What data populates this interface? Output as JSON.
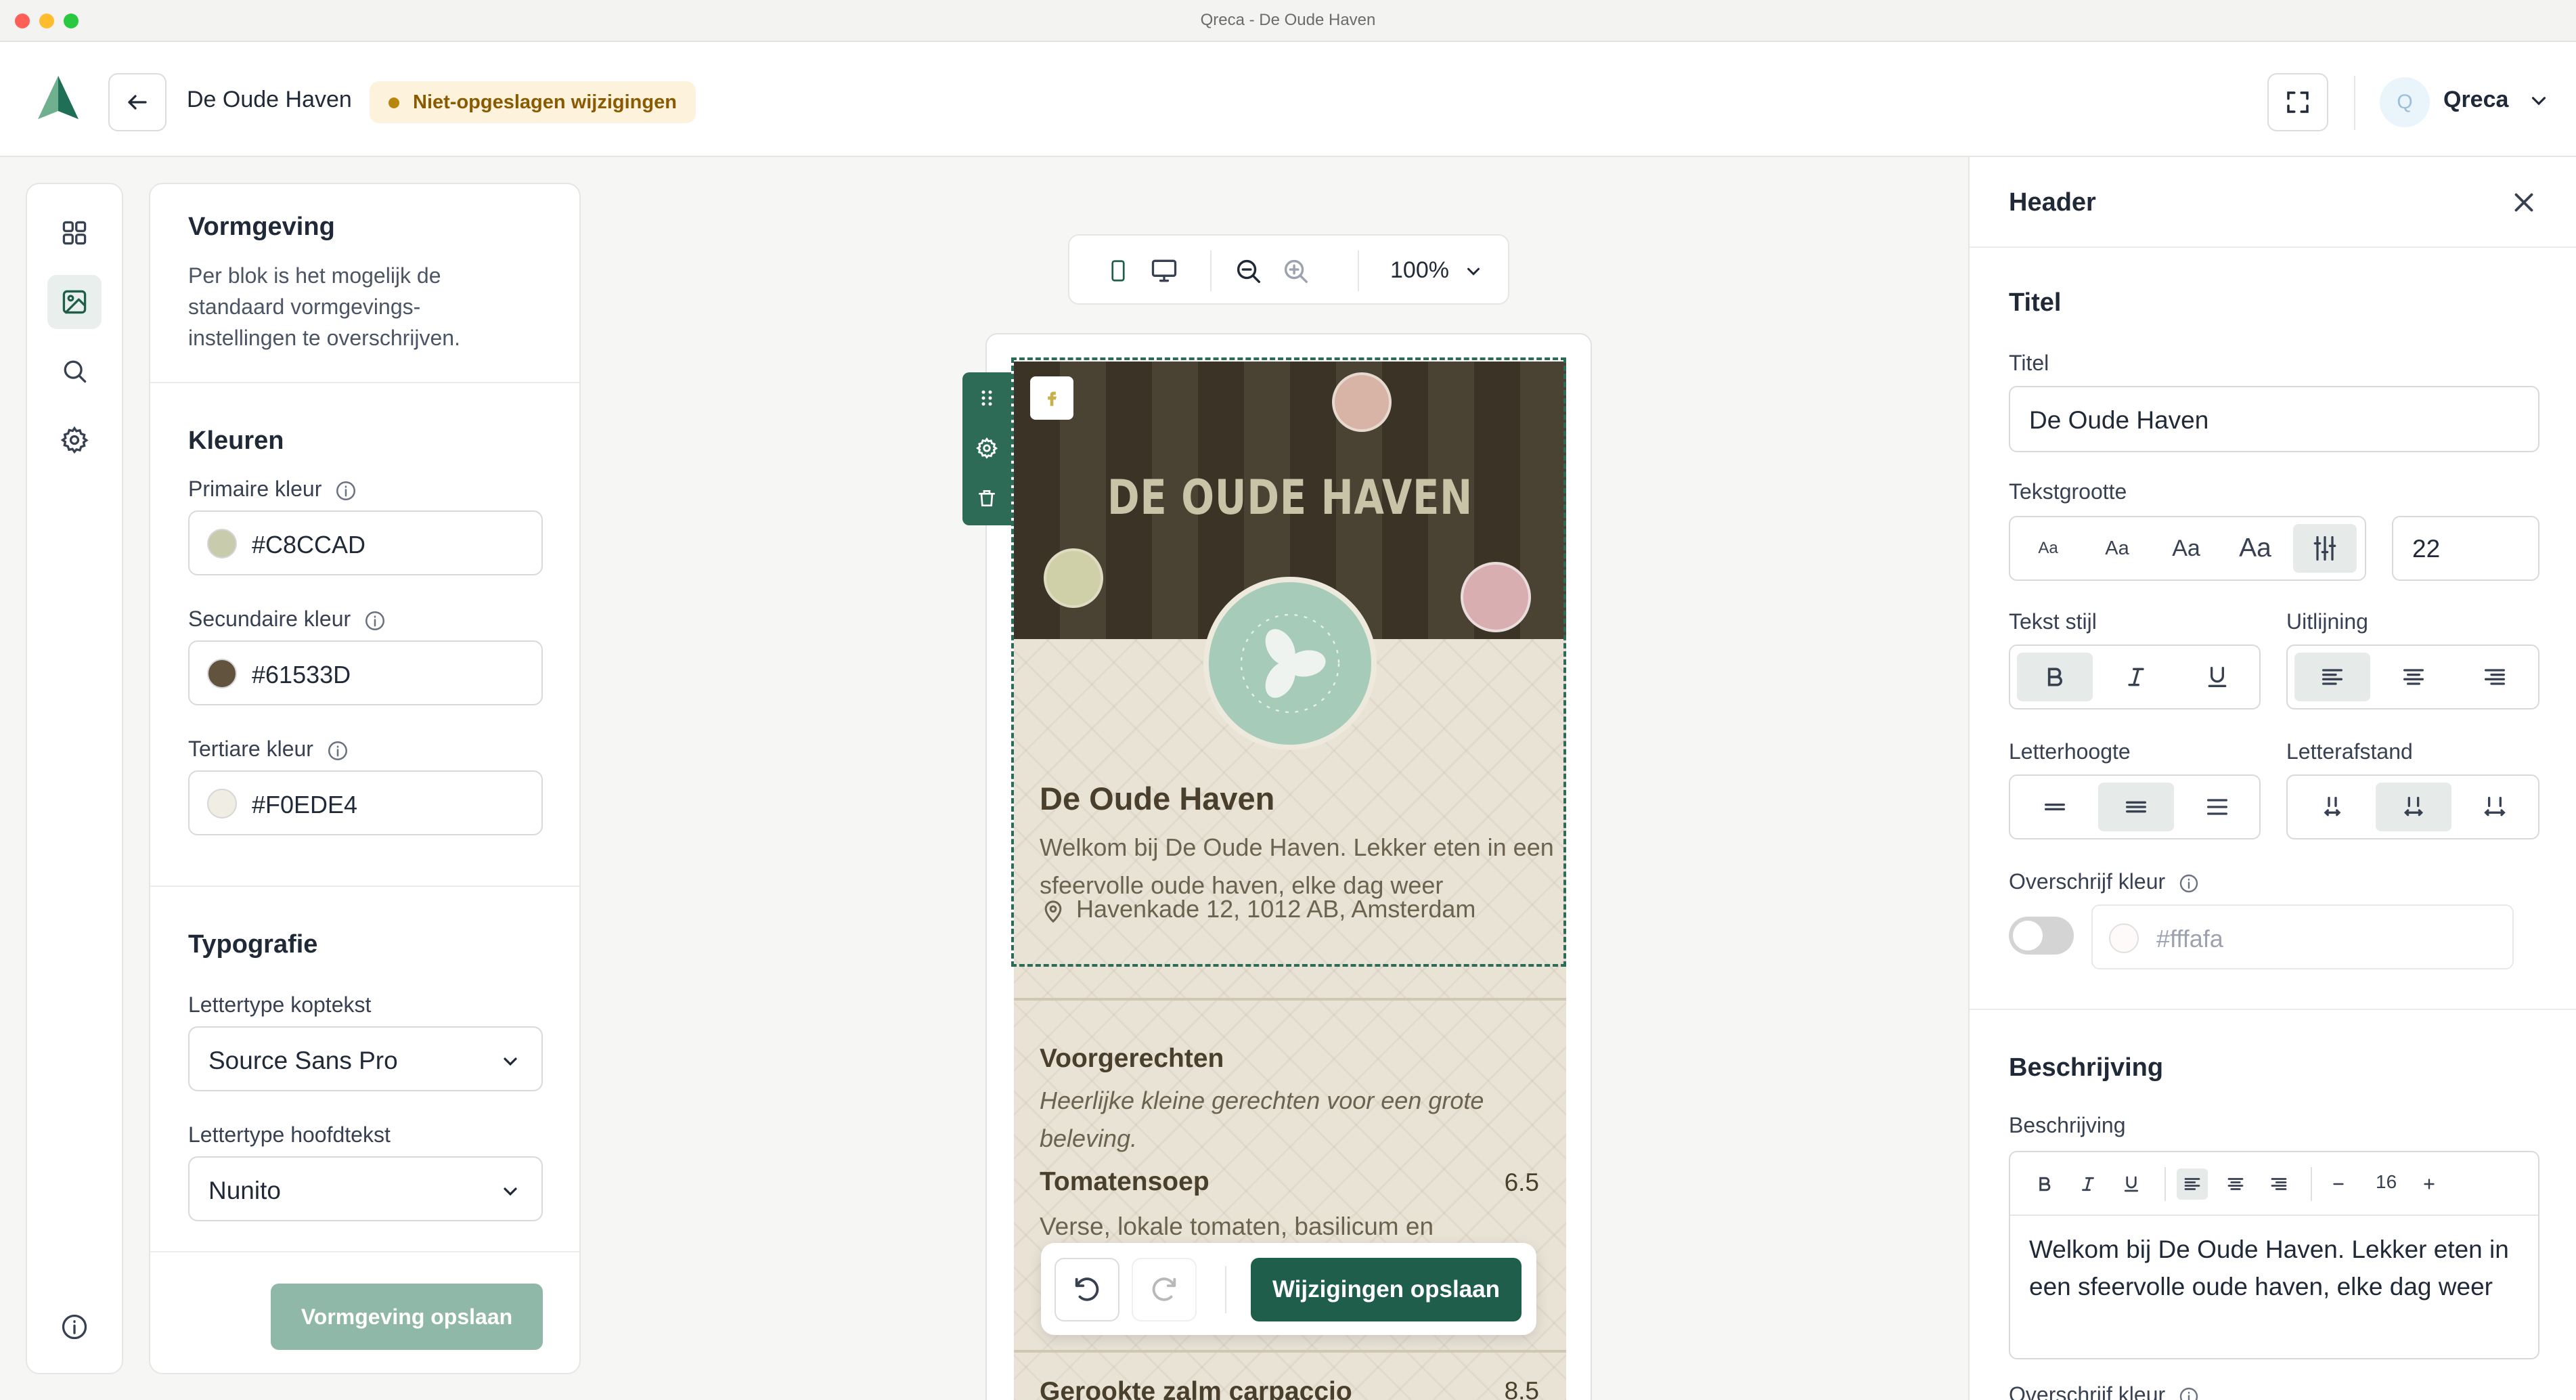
{
  "window": {
    "title": "Qreca - De Oude Haven"
  },
  "header": {
    "project_name": "De Oude Haven",
    "unsaved_badge": "Niet-opgeslagen wijzigingen",
    "user_initial": "Q",
    "user_name": "Qreca"
  },
  "rail": {
    "items": [
      "grid-icon",
      "image-icon",
      "search-icon",
      "gear-icon",
      "info-icon"
    ],
    "active": "image-icon"
  },
  "design_panel": {
    "title": "Vormgeving",
    "description": "Per blok is het mogelijk de standaard vormgevings-instellingen te overschrijven.",
    "colors": {
      "title": "Kleuren",
      "primary_label": "Primaire kleur",
      "primary_value": "#C8CCAD",
      "secondary_label": "Secundaire kleur",
      "secondary_value": "#61533D",
      "tertiary_label": "Tertiare kleur",
      "tertiary_value": "#F0EDE4"
    },
    "typography": {
      "title": "Typografie",
      "heading_font_label": "Lettertype koptekst",
      "heading_font_value": "Source Sans Pro",
      "body_font_label": "Lettertype hoofdtekst",
      "body_font_value": "Nunito"
    },
    "save_label": "Vormgeving opslaan"
  },
  "canvas_toolbar": {
    "zoom": "100%"
  },
  "preview": {
    "banner_title": "DE OUDE HAVEN",
    "restaurant_name": "De Oude Haven",
    "description": "Welkom bij De Oude Haven. Lekker eten in een sfeervolle oude haven, elke dag weer",
    "address": "Havenkade 12, 1012 AB, Amsterdam",
    "category_title": "Voorgerechten",
    "category_description": "Heerlijke kleine gerechten voor een grote beleving.",
    "item1_name": "Tomatensoep",
    "item1_price": "6.5",
    "item1_description": "Verse, lokale tomaten, basilicum en",
    "item2_name": "Gerookte zalm carpaccio",
    "item2_price": "8.5"
  },
  "savebar": {
    "save_label": "Wijzigingen opslaan"
  },
  "props_panel": {
    "title": "Header",
    "title_section": {
      "heading": "Titel",
      "title_label": "Titel",
      "title_value": "De Oude Haven",
      "size_label": "Tekstgrootte",
      "size_options": [
        "Aa",
        "Aa",
        "Aa",
        "Aa"
      ],
      "size_value": "22",
      "style_label": "Tekst stijl",
      "align_label": "Uitlijning",
      "line_height_label": "Letterhoogte",
      "letter_spacing_label": "Letterafstand",
      "override_color_label": "Overschrijf kleur",
      "override_color_value": "#fffafa"
    },
    "description_section": {
      "heading": "Beschrijving",
      "label": "Beschrijving",
      "font_size": "16",
      "text": "Welkom bij De Oude Haven. Lekker eten in een sfeervolle oude haven, elke dag weer",
      "override_color_label": "Overschrijf kleur"
    }
  },
  "colors": {
    "accent": "#2e6b57",
    "primary": "#C8CCAD",
    "secondary": "#61533D",
    "tertiary": "#F0EDE4"
  }
}
